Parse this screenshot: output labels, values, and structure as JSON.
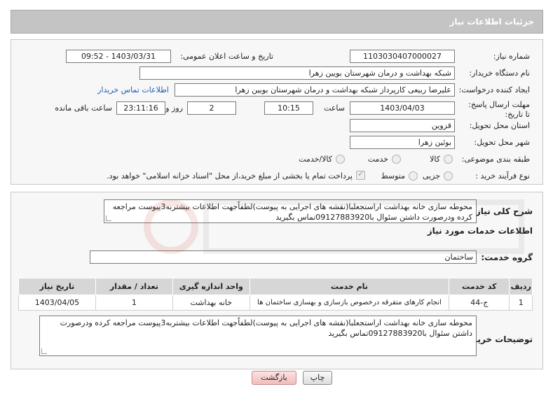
{
  "header": {
    "title": "جزئیات اطلاعات نیاز"
  },
  "fields": {
    "need_number_label": "شماره نیاز:",
    "need_number": "1103030407000027",
    "announce_label": "تاریخ و ساعت اعلان عمومی:",
    "announce_value": "1403/03/31 - 09:52",
    "buyer_org_label": "نام دستگاه خریدار:",
    "buyer_org": "شبکه بهداشت و درمان شهرستان بویین زهرا",
    "creator_label": "ایجاد کننده درخواست:",
    "creator": "علیرضا ربیعی کارپرداز شبکه بهداشت و درمان شهرستان بویین زهرا",
    "contact_link": "اطلاعات تماس خریدار",
    "deadline_label": "مهلت ارسال پاسخ: تا تاریخ:",
    "deadline_date": "1403/04/03",
    "time_label": "ساعت",
    "deadline_time": "10:15",
    "days_value": "2",
    "days_label": "روز و",
    "remaining_time": "23:11:16",
    "remaining_label": "ساعت باقی مانده",
    "province_label": "استان محل تحویل:",
    "province": "قزوین",
    "city_label": "شهر محل تحویل:",
    "city": "بوئین زهرا",
    "category_label": "طبقه بندی موضوعی:",
    "category_options": [
      "کالا",
      "خدمت",
      "کالا/خدمت"
    ],
    "process_label": "نوع فرآیند خرید :",
    "process_options": [
      "جزیی",
      "متوسط"
    ],
    "payment_note": "پرداخت تمام یا بخشی از مبلغ خرید،از محل \"اسناد خزانه اسلامی\" خواهد بود."
  },
  "details": {
    "summary_label": "شرح کلی نیاز:",
    "summary": "محوطه سازی خانه بهداشت اراستجعلبا(نقشه های اجرایی به پیوست)لطفاًجهت اطلاعات بیشتربه3پیوست مراجعه کرده ودرصورت داشتن سئوال با09127883920تماس بگیرید",
    "services_title": "اطلاعات خدمات مورد نیاز",
    "service_group_label": "گروه خدمت:",
    "service_group": "ساختمان",
    "table": {
      "headers": [
        "ردیف",
        "کد خدمت",
        "نام خدمت",
        "واحد اندازه گیری",
        "تعداد / مقدار",
        "تاریخ نیاز"
      ],
      "rows": [
        [
          "1",
          "ج-44",
          "انجام کارهای متفرقه درخصوص بازسازی و بهسازی ساختمان ها",
          "خانه بهداشت",
          "1",
          "1403/04/05"
        ]
      ]
    },
    "buyer_notes_label": "توضیحات خریدار:",
    "buyer_notes": "محوطه سازی خانه بهداشت اراستجعلبا(نقشه های اجرایی به پیوست)لطفاًجهت اطلاعات بیشتربه3پیوست مراجعه کرده ودرصورت داشتن سئوال با09127883920تماس بگیرید"
  },
  "buttons": {
    "print": "چاپ",
    "back": "بازگشت"
  },
  "colors": {
    "header_bg": "#c4c4c4",
    "link": "#1a5fb4",
    "back_button": "#f3bcbc"
  }
}
